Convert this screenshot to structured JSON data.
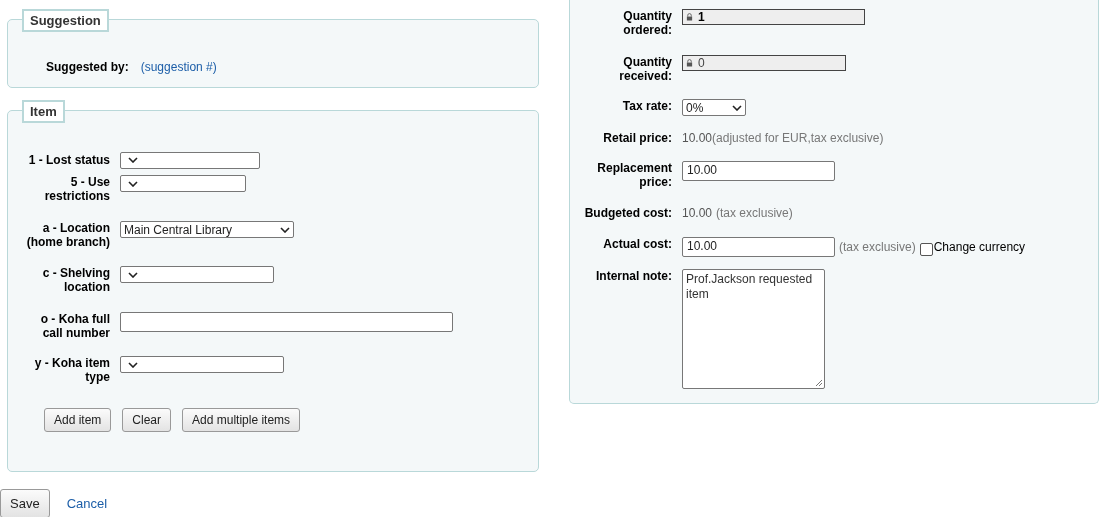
{
  "suggestion": {
    "legend": "Suggestion",
    "label": "Suggested by:",
    "value": "(suggestion #)"
  },
  "item": {
    "legend": "Item",
    "fields": [
      {
        "label": "1 - Lost status",
        "kind": "select"
      },
      {
        "label": "5 - Use restrictions",
        "kind": "select"
      },
      {
        "label": "a - Location (home branch)",
        "kind": "select",
        "value": "Main Central Library"
      },
      {
        "label": "c - Shelving location",
        "kind": "select"
      },
      {
        "label": "o - Koha full call number",
        "kind": "text"
      },
      {
        "label": "y - Koha item type",
        "kind": "select"
      }
    ],
    "buttons": [
      "Add item",
      "Clear",
      "Add multiple items"
    ]
  },
  "order": [
    {
      "label": "Quantity ordered:",
      "kind": "locked",
      "value": "1"
    },
    {
      "label": "Quantity received:",
      "kind": "locked",
      "value": "0"
    },
    {
      "label": "Tax rate:",
      "kind": "select",
      "value": "0%"
    },
    {
      "label": "Retail price:",
      "kind": "static",
      "value": "10.00",
      "note": "(adjusted for EUR,tax exclusive)"
    },
    {
      "label": "Replacement price:",
      "kind": "input",
      "value": "10.00"
    },
    {
      "label": "Budgeted cost:",
      "kind": "static",
      "value": "10.00",
      "note": "(tax exclusive)"
    },
    {
      "label": "Actual cost:",
      "kind": "input",
      "value": "10.00",
      "note": "(tax exclusive)",
      "checkbox": {
        "label": "Change currency",
        "checked": false
      }
    },
    {
      "label": "Internal note:",
      "kind": "textarea",
      "value": "Prof.Jackson requested item"
    }
  ],
  "actions": {
    "save": "Save",
    "cancel": "Cancel"
  }
}
